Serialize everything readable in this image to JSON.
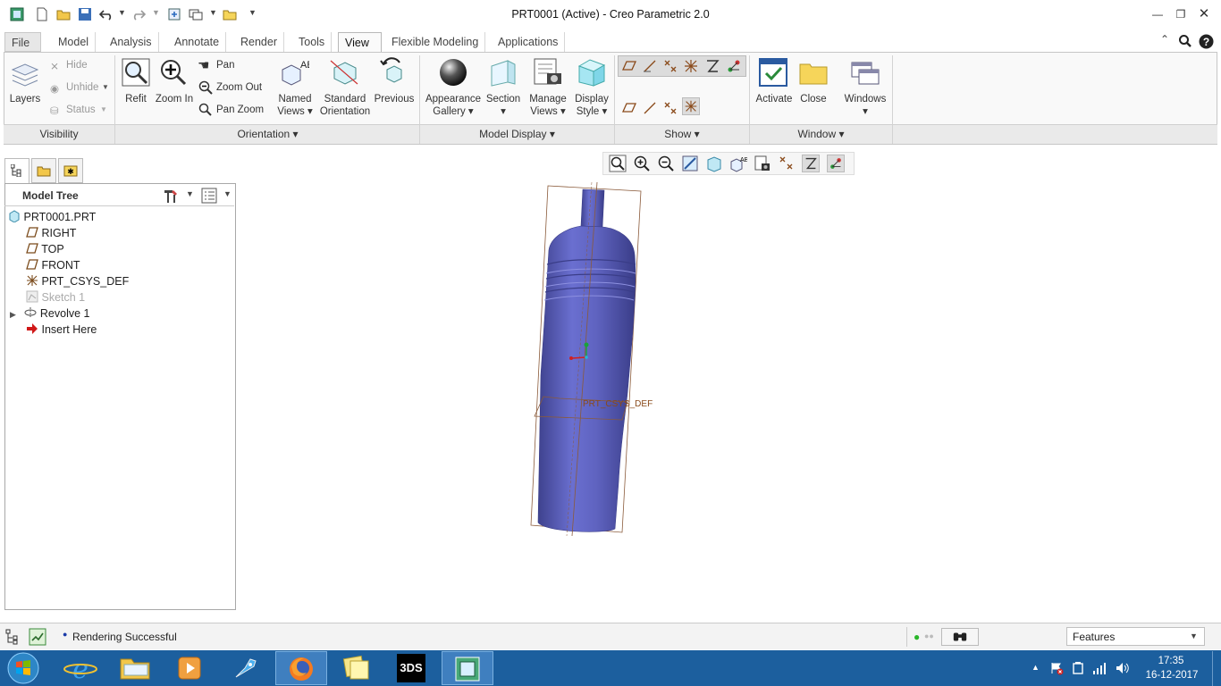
{
  "window": {
    "title": "PRT0001 (Active) - Creo Parametric 2.0"
  },
  "tabs": [
    {
      "label": "File"
    },
    {
      "label": "Model"
    },
    {
      "label": "Analysis"
    },
    {
      "label": "Annotate"
    },
    {
      "label": "Render"
    },
    {
      "label": "Tools"
    },
    {
      "label": "View"
    },
    {
      "label": "Flexible Modeling"
    },
    {
      "label": "Applications"
    }
  ],
  "ribbon": {
    "layers": "Layers",
    "hide": "Hide",
    "unhide": "Unhide",
    "status": "Status",
    "refit": "Refit",
    "zoom_in": "Zoom In",
    "pan": "Pan",
    "zoom_out": "Zoom Out",
    "pan_zoom": "Pan Zoom",
    "named_views_1": "Named",
    "named_views_2": "Views",
    "std_orient_1": "Standard",
    "std_orient_2": "Orientation",
    "previous": "Previous",
    "appearance_1": "Appearance",
    "appearance_2": "Gallery",
    "section": "Section",
    "manage_views_1": "Manage",
    "manage_views_2": "Views",
    "display_style_1": "Display",
    "display_style_2": "Style",
    "activate": "Activate",
    "close": "Close",
    "windows": "Windows",
    "ab_text": "AB"
  },
  "groups": {
    "visibility": "Visibility",
    "orientation": "Orientation",
    "model_display": "Model Display",
    "show": "Show",
    "window": "Window"
  },
  "model_tree": {
    "title": "Model Tree",
    "items": [
      {
        "label": "PRT0001.PRT",
        "icon": "part-icon"
      },
      {
        "label": "RIGHT",
        "icon": "datum-plane-icon"
      },
      {
        "label": "TOP",
        "icon": "datum-plane-icon"
      },
      {
        "label": "FRONT",
        "icon": "datum-plane-icon"
      },
      {
        "label": "PRT_CSYS_DEF",
        "icon": "csys-icon"
      },
      {
        "label": "Sketch 1",
        "icon": "sketch-icon",
        "suppressed": true
      },
      {
        "label": "Revolve 1",
        "icon": "revolve-icon"
      },
      {
        "label": "Insert Here",
        "icon": "insert-arrow-icon"
      }
    ]
  },
  "viewport": {
    "csys_label": "PRT_CSYS_DEF"
  },
  "status": {
    "message": "Rendering Successful",
    "filter": "Features"
  },
  "taskbar": {
    "time": "17:35",
    "date": "16-12-2017"
  },
  "colors": {
    "model_body": "#5f63c0",
    "accent_blue": "#2b7bd0",
    "taskbar": "#1c5f9e"
  }
}
